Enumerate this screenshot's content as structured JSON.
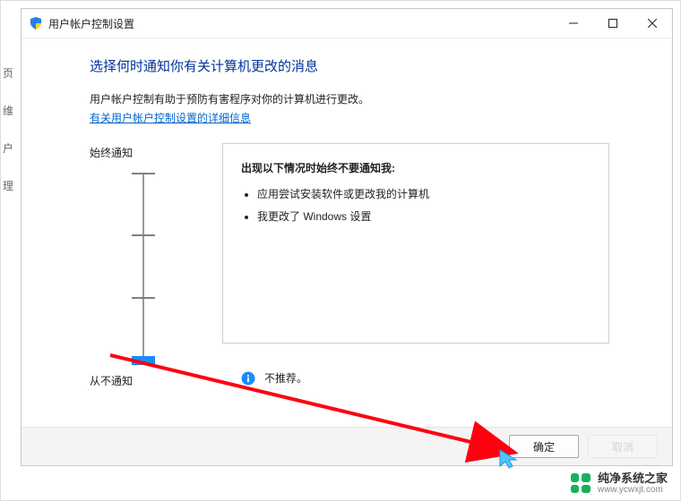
{
  "bg_hints": {
    "a": "页",
    "b": "维",
    "c": "户",
    "d": "理"
  },
  "window": {
    "title": "用户帐户控制设置",
    "heading": "选择何时通知你有关计算机更改的消息",
    "description": "用户帐户控制有助于预防有害程序对你的计算机进行更改。",
    "help_link": "有关用户帐户控制设置的详细信息"
  },
  "slider": {
    "top_label": "始终通知",
    "bottom_label": "从不通知",
    "levels": 4,
    "current_level": 0
  },
  "panel": {
    "title": "出现以下情况时始终不要通知我:",
    "items": [
      "应用尝试安装软件或更改我的计算机",
      "我更改了 Windows 设置"
    ],
    "recommendation": "不推荐。"
  },
  "buttons": {
    "ok": "确定",
    "cancel": "取消"
  },
  "icons": {
    "shield": "shield-icon",
    "minimize": "minimize-icon",
    "maximize": "maximize-icon",
    "close": "close-icon",
    "info": "info-icon"
  },
  "watermark": {
    "name": "纯净系统之家",
    "url": "www.ycwxjt.com"
  },
  "colors": {
    "heading": "#003399",
    "link": "#0066cc",
    "slider_thumb": "#1a8cff",
    "arrow": "#ff0010",
    "wm_green": "#17b15b"
  }
}
